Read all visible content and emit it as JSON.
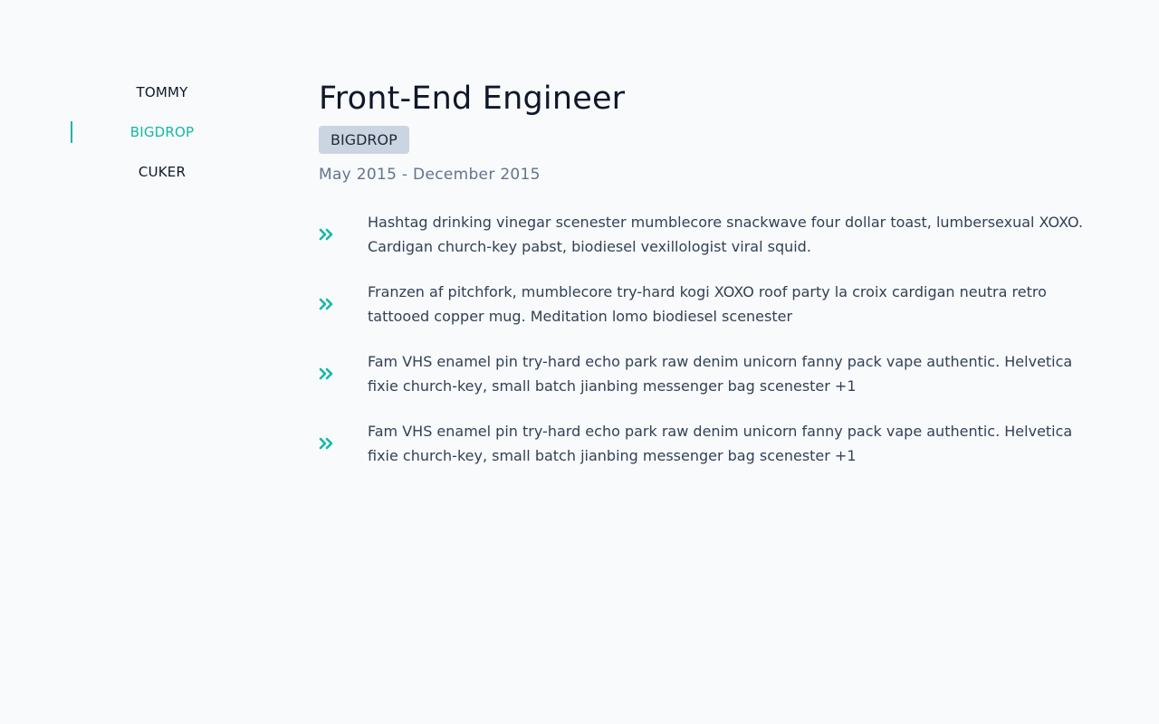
{
  "tabs": [
    {
      "label": "TOMMY",
      "active": false
    },
    {
      "label": "BIGDROP",
      "active": true
    },
    {
      "label": "CUKER",
      "active": false
    }
  ],
  "job": {
    "title": "Front-End Engineer",
    "company": "BIGDROP",
    "dates": "May 2015 - December 2015",
    "bullet_icon": "double-chevron-right-icon",
    "points": [
      "Hashtag drinking vinegar scenester mumblecore snackwave four dollar toast, lumbersexual XOXO. Cardigan church-key pabst, biodiesel vexillologist viral squid.",
      "Franzen af pitchfork, mumblecore try-hard kogi XOXO roof party la croix cardigan neutra retro tattooed copper mug. Meditation lomo biodiesel scenester",
      "Fam VHS enamel pin try-hard echo park raw denim unicorn fanny pack vape authentic. Helvetica fixie church-key, small batch jianbing messenger bag scenester +1",
      "Fam VHS enamel pin try-hard echo park raw denim unicorn fanny pack vape authentic. Helvetica fixie church-key, small batch jianbing messenger bag scenester +1"
    ]
  },
  "colors": {
    "accent": "#14b8a6",
    "background": "#f8fafc",
    "badge_bg": "#cbd5e1",
    "title": "#0f172a",
    "muted": "#64748b"
  }
}
